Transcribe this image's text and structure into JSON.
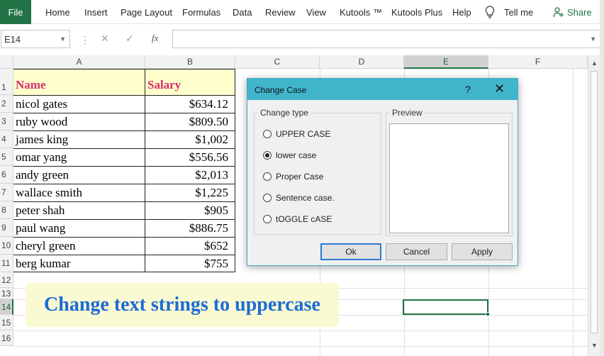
{
  "ribbon": {
    "file": "File",
    "tabs": [
      "Home",
      "Insert",
      "Page Layout",
      "Formulas",
      "Data",
      "Review",
      "View",
      "Kutools ™",
      "Kutools Plus",
      "Help"
    ],
    "tell_me": "Tell me",
    "share": "Share"
  },
  "formula_bar": {
    "name_box": "E14",
    "fx": "fx",
    "formula": ""
  },
  "columns": [
    "A",
    "B",
    "C",
    "D",
    "E",
    "F"
  ],
  "rows": [
    "1",
    "2",
    "3",
    "4",
    "5",
    "6",
    "7",
    "8",
    "9",
    "10",
    "11",
    "12",
    "13",
    "14",
    "15",
    "16"
  ],
  "table": {
    "headers": [
      "Name",
      "Salary"
    ],
    "rows": [
      [
        "nicol gates",
        "$634.12"
      ],
      [
        "ruby wood",
        "$809.50"
      ],
      [
        "james king",
        "$1,002"
      ],
      [
        "omar yang",
        "$556.56"
      ],
      [
        "andy green",
        "$2,013"
      ],
      [
        "wallace smith",
        "$1,225"
      ],
      [
        "peter shah",
        "$905"
      ],
      [
        "paul wang",
        "$886.75"
      ],
      [
        "cheryl green",
        "$652"
      ],
      [
        "berg kumar",
        "$755"
      ]
    ]
  },
  "banner": "Change text strings to uppercase",
  "dialog": {
    "title": "Change Case",
    "help": "?",
    "close": "✕",
    "change_type_label": "Change type",
    "preview_label": "Preview",
    "options": [
      {
        "label": "UPPER CASE",
        "selected": false
      },
      {
        "label": "lower case",
        "selected": true
      },
      {
        "label": "Proper Case",
        "selected": false
      },
      {
        "label": "Sentence case.",
        "selected": false
      },
      {
        "label": "tOGGLE cASE",
        "selected": false
      }
    ],
    "ok": "Ok",
    "cancel": "Cancel",
    "apply": "Apply"
  },
  "colors": {
    "excel_green": "#217346",
    "header_text": "#d62b6a",
    "header_fill": "#ffffcc",
    "banner_text": "#1c6ad6",
    "dialog_title": "#40b5cc"
  }
}
